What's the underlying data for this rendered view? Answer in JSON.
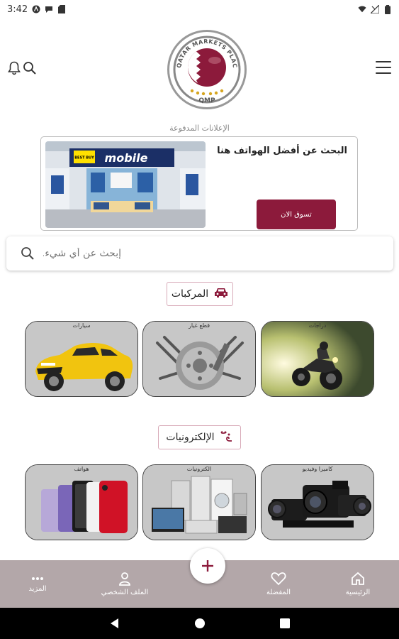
{
  "status_bar": {
    "time": "3:42"
  },
  "header": {
    "logo_text": "QATAR MARKETS PLACE",
    "logo_abbr": "QMP"
  },
  "paid_ads_label": "الإعلانات المدفوعة",
  "banner": {
    "title": "البحث عن أفضل الهواتف هنا",
    "button_label": "تسوق الان",
    "store_sign": "mobile",
    "store_brand": "BEST BUY"
  },
  "search": {
    "placeholder": "إبحث عن أي شيء..."
  },
  "sections": [
    {
      "title": "المركبات",
      "icon": "car-icon",
      "items": [
        {
          "label": "سيارات"
        },
        {
          "label": "قطع غيار"
        },
        {
          "label": "دراجات"
        }
      ]
    },
    {
      "title": "الإلكترونيات",
      "icon": "electronics-icon",
      "items": [
        {
          "label": "هواتف"
        },
        {
          "label": "الكترونيات"
        },
        {
          "label": "كاميرا وفيديو"
        }
      ]
    }
  ],
  "bottom_nav": {
    "more": "المزيد",
    "profile": "الملف الشخصي",
    "favorites": "المفضلة",
    "home": "الرئيسية"
  },
  "colors": {
    "brand": "#8c1a3b",
    "nav_bg": "#b3a7a9",
    "card_bg": "#c5c5c5"
  }
}
